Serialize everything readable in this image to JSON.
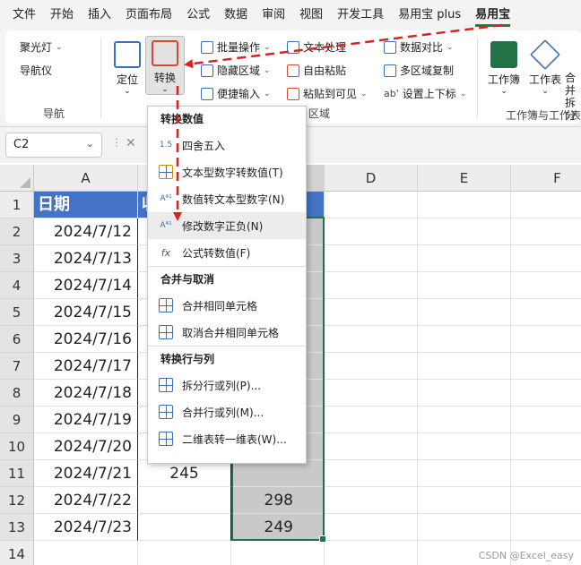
{
  "menubar": {
    "tabs": [
      "文件",
      "开始",
      "插入",
      "页面布局",
      "公式",
      "数据",
      "审阅",
      "视图",
      "开发工具",
      "易用宝 plus",
      "易用宝"
    ],
    "active_tab": "易用宝"
  },
  "ribbon": {
    "spotlight": "聚光灯",
    "navigator": "导航仪",
    "locate": "定位",
    "nav_group": "导航",
    "convert": "转换",
    "batch_ops": "批量操作",
    "text_process": "文本处理",
    "data_compare": "数据对比",
    "hide_area": "隐藏区域",
    "free_paste": "自由粘贴",
    "multi_area_copy": "多区域复制",
    "easy_input": "便捷输入",
    "paste_visible": "粘贴到可见",
    "sub_superscript": "设置上下标",
    "area_group_partial": "区域",
    "workbook": "工作簿",
    "worksheet": "工作表",
    "merge_partial_1": "合并",
    "merge_partial_2": "拆分",
    "wb_ws_group": "工作簿与工作表"
  },
  "formula_bar": {
    "name_box": "C2",
    "cancel": "✕"
  },
  "sheet": {
    "columns": [
      "A",
      "B",
      "C",
      "D",
      "E",
      "F"
    ],
    "rows": [
      "1",
      "2",
      "3",
      "4",
      "5",
      "6",
      "7",
      "8",
      "9",
      "10",
      "11",
      "12",
      "13",
      "14"
    ],
    "header_date": "日期",
    "header_b_partial": "收",
    "dates": [
      "2024/7/12",
      "2024/7/13",
      "2024/7/14",
      "2024/7/15",
      "2024/7/16",
      "2024/7/17",
      "2024/7/18",
      "2024/7/19",
      "2024/7/20",
      "2024/7/21",
      "2024/7/22",
      "2024/7/23"
    ],
    "b11": "245",
    "c12": "298",
    "c13": "249"
  },
  "dropdown": {
    "section_convert_values": "转换数值",
    "round": "四舍五入",
    "text_to_number": "文本型数字转数值(T)",
    "number_to_text": "数值转文本型数字(N)",
    "fix_sign": "修改数字正负(N)",
    "formula_to_value": "公式转数值(F)",
    "section_merge": "合并与取消",
    "merge_same": "合并相同单元格",
    "unmerge_same": "取消合并相同单元格",
    "section_rows_cols": "转换行与列",
    "split_rows_cols": "拆分行或列(P)...",
    "merge_rows_cols": "合并行或列(M)...",
    "two_to_one": "二维表转一维表(W)..."
  },
  "watermark": "CSDN @Excel_easy",
  "colors": {
    "header_blue": "#4472c4",
    "selection_green": "#217346",
    "arrow_red": "#e02020",
    "active_tab_underline": "#2b7a3a"
  }
}
